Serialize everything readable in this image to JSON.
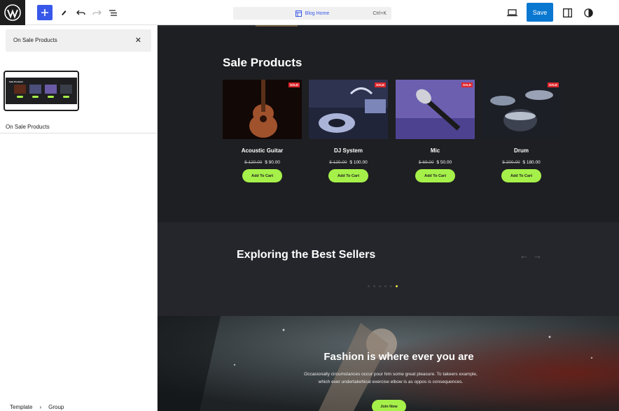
{
  "toolbar": {
    "command_title": "Blog Home",
    "command_shortcut": "Ctrl+K",
    "save_label": "Save"
  },
  "sidebar": {
    "search_value": "On Sale Products",
    "pattern_label": "On Sale Products",
    "preview_title": "Sale Products",
    "breadcrumb": [
      "Template",
      "Group"
    ]
  },
  "sale_section": {
    "title": "Sale Products",
    "badge": "SALE",
    "button_label": "Add To Cart",
    "products": [
      {
        "name": "Acoustic Guitar",
        "old_price": "$ 120.00",
        "price": "$ 90.00"
      },
      {
        "name": "DJ System",
        "old_price": "$ 120.00",
        "price": "$ 100.00"
      },
      {
        "name": "Mic",
        "old_price": "$ 69.00",
        "price": "$ 50.00"
      },
      {
        "name": "Drum",
        "old_price": "$ 200.00",
        "price": "$ 180.00"
      }
    ]
  },
  "best_sellers": {
    "title": "Exploring the Best Sellers"
  },
  "hero": {
    "title": "Fashion is where ever you are",
    "text": "Occasionally circumstances occur pour him some great pleasure. To takeers example, which ever undertakehical exercise elbow is as oppos is consequences.",
    "button_label": "Join Now"
  },
  "colors": {
    "accent_green": "#a6f04a",
    "save_blue": "#0a78d1",
    "wp_blue": "#3858e9",
    "sale_red": "#e0262b"
  }
}
